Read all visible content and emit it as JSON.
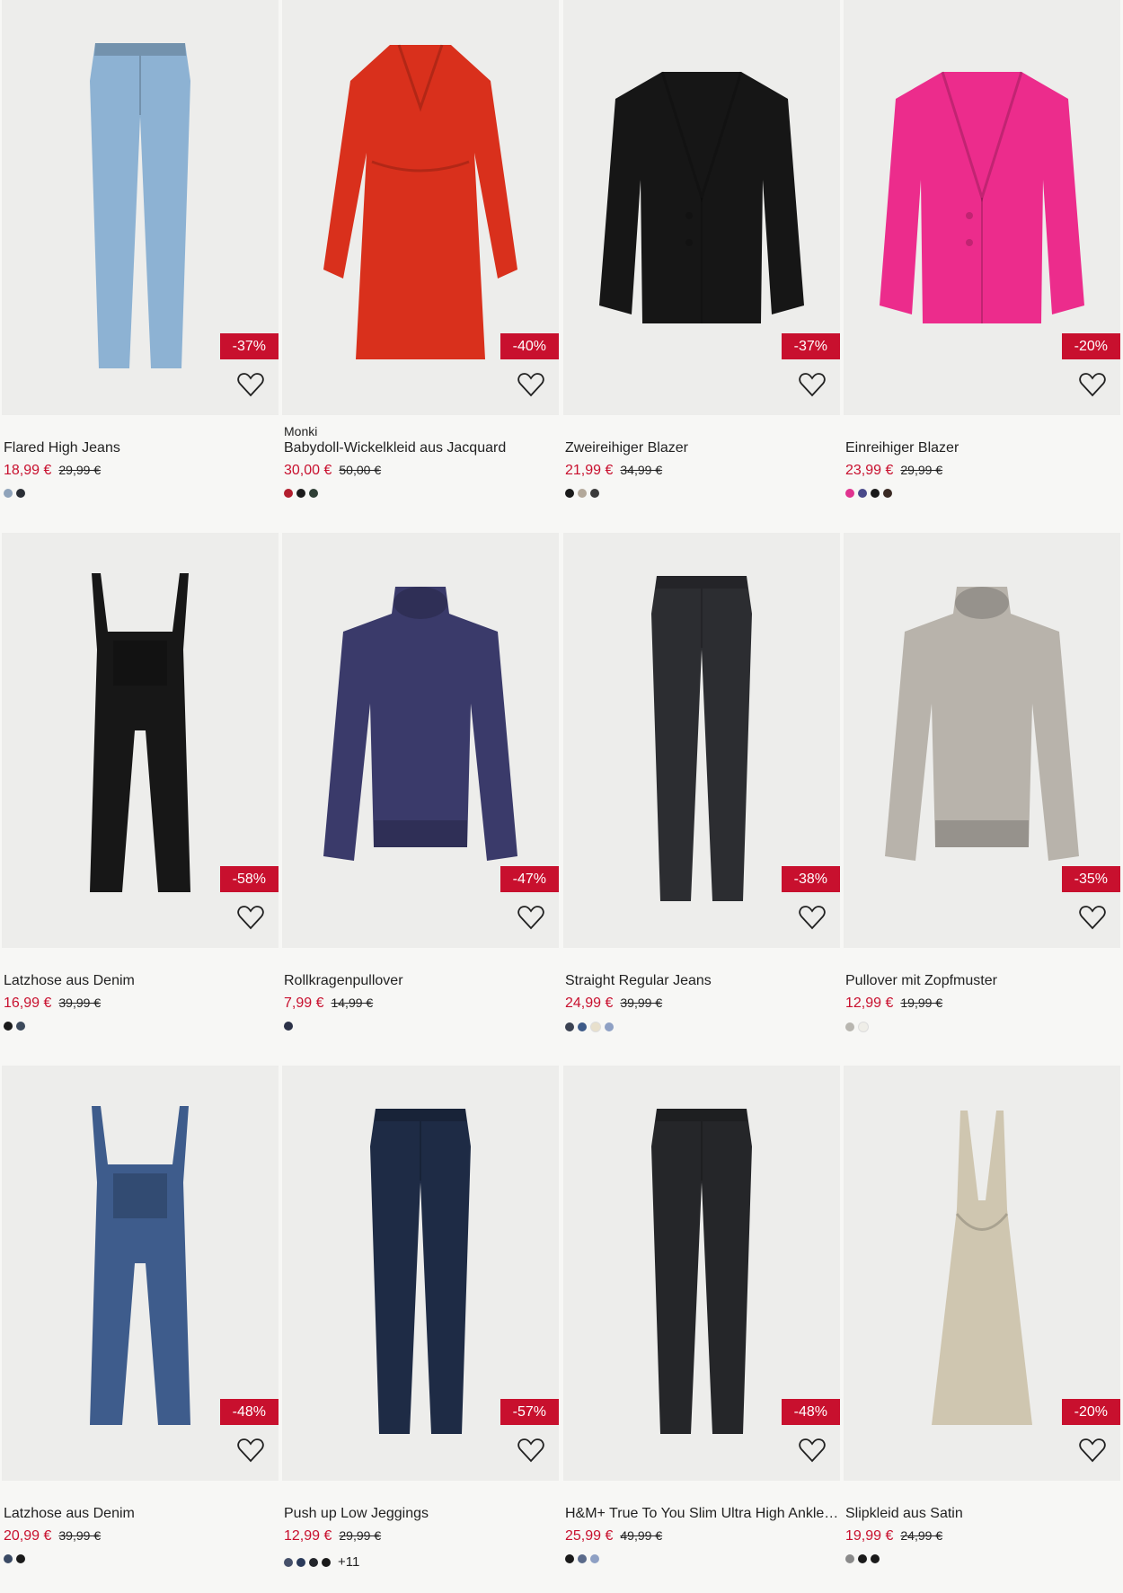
{
  "products": [
    {
      "brand": "",
      "name": "Flared High Jeans",
      "price": "18,99 €",
      "old_price": "29,99 €",
      "discount": "-37%",
      "colors": [
        "#8fa3ba",
        "#2b2f36"
      ],
      "more": "",
      "garment": "jeans",
      "garment_color": "#8db2d3"
    },
    {
      "brand": "Monki",
      "name": "Babydoll-Wickelkleid aus Jacquard",
      "price": "30,00 €",
      "old_price": "50,00 €",
      "discount": "-40%",
      "colors": [
        "#b21e2e",
        "#1c1c1c",
        "#2f3f36"
      ],
      "more": "",
      "garment": "dress",
      "garment_color": "#d9301c"
    },
    {
      "brand": "",
      "name": "Zweireihiger Blazer",
      "price": "21,99 €",
      "old_price": "34,99 €",
      "discount": "-37%",
      "colors": [
        "#1a1a1a",
        "#b3a89a",
        "#3a3a3a"
      ],
      "more": "",
      "garment": "blazer",
      "garment_color": "#161616"
    },
    {
      "brand": "",
      "name": "Einreihiger Blazer",
      "price": "23,99 €",
      "old_price": "29,99 €",
      "discount": "-20%",
      "colors": [
        "#e0338f",
        "#4a4a8a",
        "#1a1a1a",
        "#3a2a24"
      ],
      "more": "",
      "garment": "blazer",
      "garment_color": "#ec2c8c"
    },
    {
      "brand": "",
      "name": "Latzhose aus Denim",
      "price": "16,99 €",
      "old_price": "39,99 €",
      "discount": "-58%",
      "colors": [
        "#1a1a1a",
        "#3d4a5c"
      ],
      "more": "",
      "garment": "overalls",
      "garment_color": "#171717"
    },
    {
      "brand": "",
      "name": "Rollkragenpullover",
      "price": "7,99 €",
      "old_price": "14,99 €",
      "discount": "-47%",
      "colors": [
        "#2b3147"
      ],
      "more": "",
      "garment": "sweater",
      "garment_color": "#3a3a6a"
    },
    {
      "brand": "",
      "name": "Straight Regular Jeans",
      "price": "24,99 €",
      "old_price": "39,99 €",
      "discount": "-38%",
      "colors": [
        "#3b4252",
        "#3d5a88",
        "#e8e0cc",
        "#8ea0c4"
      ],
      "more": "",
      "garment": "jeans",
      "garment_color": "#2c2d31"
    },
    {
      "brand": "",
      "name": "Pullover mit Zopfmuster",
      "price": "12,99 €",
      "old_price": "19,99 €",
      "discount": "-35%",
      "colors": [
        "#b8b6b0",
        "#efeee8"
      ],
      "more": "",
      "garment": "sweater",
      "garment_color": "#b8b3ab"
    },
    {
      "brand": "",
      "name": "Latzhose aus Denim",
      "price": "20,99 €",
      "old_price": "39,99 €",
      "discount": "-48%",
      "colors": [
        "#3a4a64",
        "#1a1a1a"
      ],
      "more": "",
      "garment": "overalls",
      "garment_color": "#3e5c8c"
    },
    {
      "brand": "",
      "name": "Push up Low Jeggings",
      "price": "12,99 €",
      "old_price": "29,99 €",
      "discount": "-57%",
      "colors": [
        "#46506a",
        "#2a3a5a",
        "#23252b",
        "#1a1a1a"
      ],
      "more": "+11",
      "garment": "jeans",
      "garment_color": "#1e2b45"
    },
    {
      "brand": "",
      "name": "H&M+ True To You Slim Ultra High Ankle Jeans",
      "price": "25,99 €",
      "old_price": "49,99 €",
      "discount": "-48%",
      "colors": [
        "#1a1a1a",
        "#5a6a8a",
        "#8ea0c4"
      ],
      "more": "",
      "garment": "jeans",
      "garment_color": "#252629"
    },
    {
      "brand": "",
      "name": "Slipkleid aus Satin",
      "price": "19,99 €",
      "old_price": "24,99 €",
      "discount": "-20%",
      "colors": [
        "#8a8a8a",
        "#1a1a1a",
        "#1a1a1a"
      ],
      "more": "",
      "garment": "slipdress",
      "garment_color": "#cfc6b0"
    }
  ]
}
